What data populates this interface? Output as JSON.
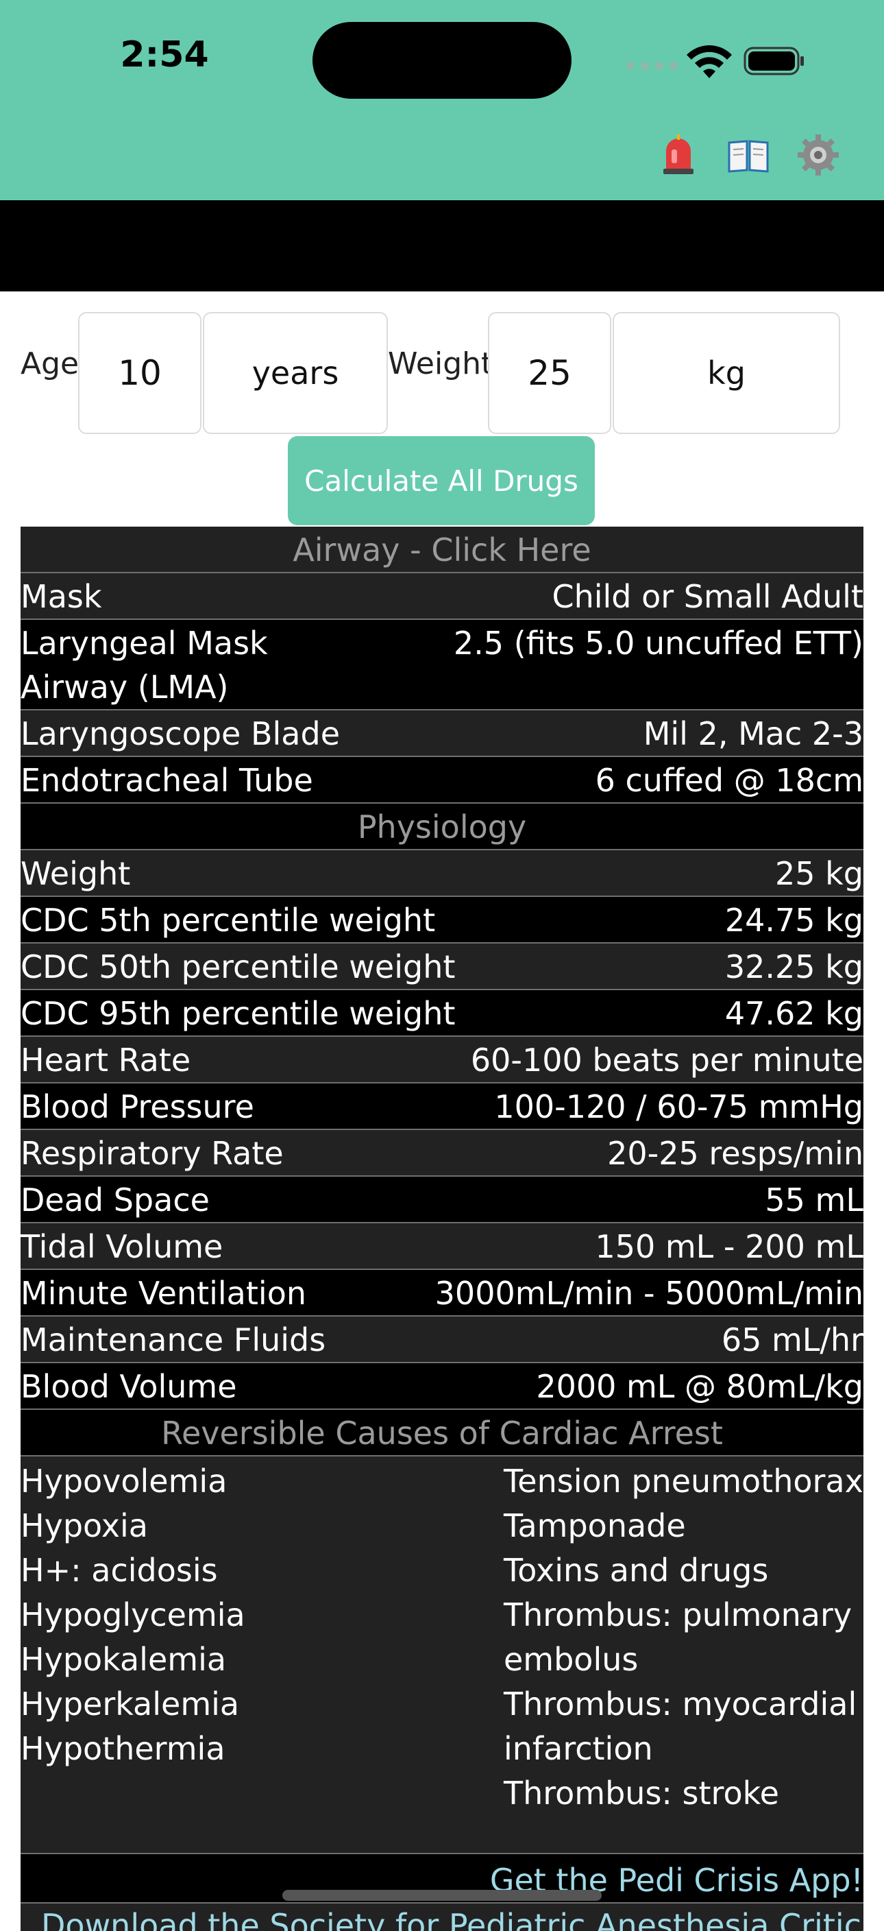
{
  "status_bar": {
    "time": "2:54"
  },
  "toolbar": {
    "icons": [
      "siren-icon",
      "book-icon",
      "gear-icon"
    ]
  },
  "inputs": {
    "age_label": "Age:",
    "age_value": "10",
    "age_unit": "years",
    "weight_label": "Weight:",
    "weight_value": "25",
    "weight_unit": "kg"
  },
  "calculate_button": "Calculate All Drugs",
  "airway": {
    "header": "Airway - Click Here",
    "rows": [
      {
        "label": "Mask",
        "value": "Child or Small Adult"
      },
      {
        "label": "Laryngeal Mask Airway (LMA)",
        "value": "2.5 (fits 5.0 uncuffed ETT)"
      },
      {
        "label": "Laryngoscope Blade",
        "value": "Mil 2, Mac 2-3"
      },
      {
        "label": "Endotracheal Tube",
        "value": "6 cuffed @ 18cm"
      }
    ]
  },
  "physiology": {
    "header": "Physiology",
    "rows": [
      {
        "label": "Weight",
        "value": "25 kg"
      },
      {
        "label": "CDC 5th percentile weight",
        "value": "24.75 kg"
      },
      {
        "label": "CDC 50th percentile weight",
        "value": "32.25 kg"
      },
      {
        "label": "CDC 95th percentile weight",
        "value": "47.62 kg"
      },
      {
        "label": "Heart Rate",
        "value": "60-100 beats per minute"
      },
      {
        "label": "Blood Pressure",
        "value": "100-120  /  60-75 mmHg"
      },
      {
        "label": "Respiratory Rate",
        "value": "20-25 resps/min"
      },
      {
        "label": "Dead Space",
        "value": "55 mL"
      },
      {
        "label": "Tidal Volume",
        "value": "150 mL - 200 mL"
      },
      {
        "label": "Minute Ventilation",
        "value": "3000mL/min - 5000mL/min"
      },
      {
        "label": "Maintenance Fluids",
        "value": "65 mL/hr"
      },
      {
        "label": "Blood Volume",
        "value": "2000 mL @ 80mL/kg"
      }
    ]
  },
  "causes": {
    "header": "Reversible Causes of Cardiac Arrest",
    "h_causes": [
      "Hypovolemia",
      "Hypoxia",
      "H+: acidosis",
      "Hypoglycemia",
      "Hypokalemia",
      "Hyperkalemia",
      "Hypothermia"
    ],
    "t_causes": [
      "Tension pneumothorax",
      "Tamponade",
      "Toxins and drugs",
      "Thrombus: pulmonary embolus",
      "Thrombus: myocardial infarction",
      "Thrombus: stroke"
    ]
  },
  "links": {
    "app_link": "Get the Pedi Crisis App!",
    "download_link": "Download the Society for Pediatric Anesthesia Critical"
  }
}
